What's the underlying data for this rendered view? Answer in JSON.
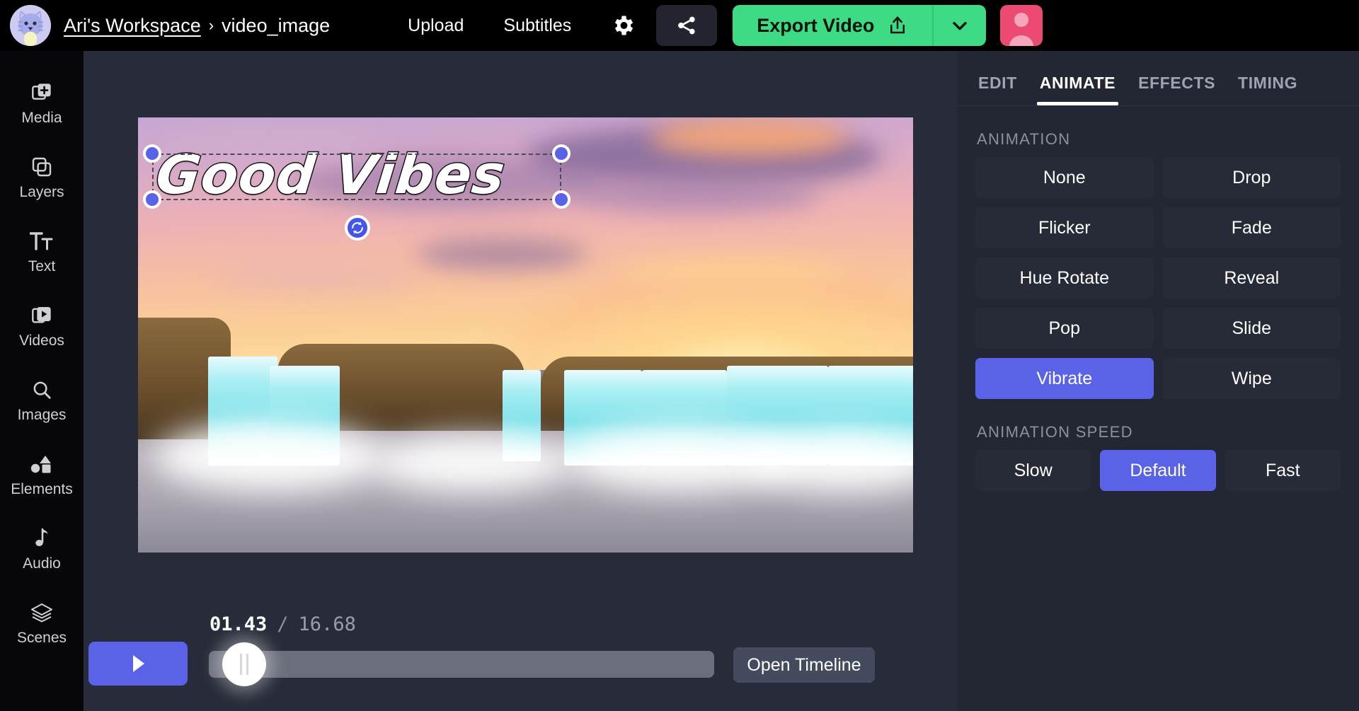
{
  "topbar": {
    "avatar_icon": "cat-avatar-icon",
    "breadcrumb": {
      "workspace": "Ari's Workspace",
      "separator": "›",
      "current": "video_image"
    },
    "nav": [
      {
        "label": "Upload",
        "name": "upload"
      },
      {
        "label": "Subtitles",
        "name": "subtitles"
      }
    ],
    "settings_icon": "gear-icon",
    "share_icon": "share-icon",
    "export_label": "Export Video",
    "export_icon": "share-export-icon",
    "export_caret_icon": "chevron-down-icon",
    "user_avatar_icon": "user-avatar-icon",
    "colors": {
      "export_green": "#3ddc84",
      "user_pink": "#ec4a72"
    }
  },
  "sidebar": {
    "items": [
      {
        "label": "Media",
        "icon": "media-add-icon"
      },
      {
        "label": "Layers",
        "icon": "layers-copy-icon"
      },
      {
        "label": "Text",
        "icon": "text-tt-icon"
      },
      {
        "label": "Videos",
        "icon": "video-play-icon"
      },
      {
        "label": "Images",
        "icon": "search-icon"
      },
      {
        "label": "Elements",
        "icon": "shapes-icon"
      },
      {
        "label": "Audio",
        "icon": "music-note-icon"
      },
      {
        "label": "Scenes",
        "icon": "stack-icon"
      }
    ]
  },
  "canvas": {
    "text_object": "Good Vibes",
    "rotate_icon": "rotate-icon",
    "handle_color": "#5a62e8",
    "scene_description": "sunset sky with waterfalls"
  },
  "playback": {
    "play_icon": "play-icon",
    "current_time": "01.43",
    "separator": "/",
    "total_time": "16.68",
    "open_timeline_label": "Open Timeline",
    "progress_percent": 8.6
  },
  "right_panel": {
    "tabs": [
      {
        "label": "EDIT",
        "active": false
      },
      {
        "label": "ANIMATE",
        "active": true
      },
      {
        "label": "EFFECTS",
        "active": false
      },
      {
        "label": "TIMING",
        "active": false
      }
    ],
    "animation": {
      "title": "ANIMATION",
      "options": [
        "None",
        "Drop",
        "Flicker",
        "Fade",
        "Hue Rotate",
        "Reveal",
        "Pop",
        "Slide",
        "Vibrate",
        "Wipe"
      ],
      "selected": "Vibrate"
    },
    "animation_speed": {
      "title": "ANIMATION SPEED",
      "options": [
        "Slow",
        "Default",
        "Fast"
      ],
      "selected": "Default"
    },
    "accent_color": "#5a62e8"
  }
}
